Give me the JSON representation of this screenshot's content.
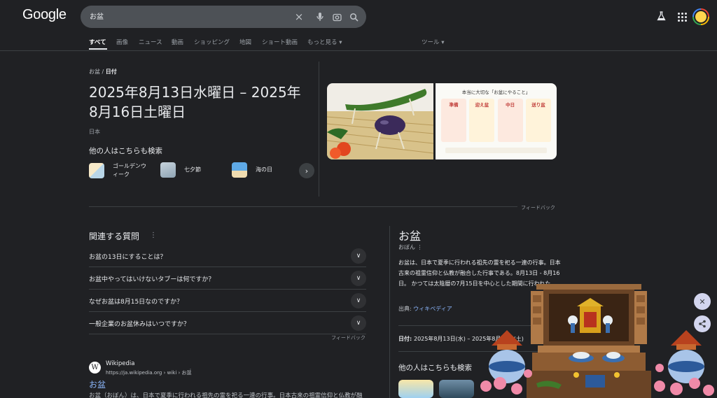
{
  "header": {
    "logo": "Google",
    "search_value": "お盆"
  },
  "tabs": [
    "すべて",
    "画像",
    "ニュース",
    "動画",
    "ショッピング",
    "地図",
    "ショート動画",
    "もっと見る ▾",
    "ツール ▾"
  ],
  "top_panel": {
    "crumb_parent": "お盆",
    "crumb_sep": " / ",
    "crumb_current": "日付",
    "date_line1": "2025年8月13日水曜日 – 2025年",
    "date_line2": "8月16日土曜日",
    "country": "日本",
    "others_heading": "他の人はこちらも検索",
    "others": [
      {
        "line1": "ゴールデンウ",
        "line2": "ィーク"
      },
      {
        "line1": "七夕節",
        "line2": ""
      },
      {
        "line1": "海の日",
        "line2": ""
      }
    ],
    "image2_title": "本当に大切な「お盆にやること」",
    "image2_cols": [
      "準備",
      "迎え盆",
      "中日",
      "送り盆"
    ],
    "feedback": "フィードバック"
  },
  "paa": {
    "heading": "関連する質問",
    "questions": [
      "お盆の13日にすることは？",
      "お盆中やってはいけないタブーは何ですか？",
      "なぜお盆は8月15日なのですか？",
      "一般企業のお盆休みはいつですか？"
    ],
    "feedback": "フィードバック"
  },
  "result": {
    "site_name": "Wikipedia",
    "url": "https://ja.wikipedia.org › wiki › お盆",
    "title": "お盆",
    "snippet": "お盆（おぼん）は、日本で夏季に行われる祖先の霊を祀る一連の行事。日本古来の祖霊信仰と仏教が融"
  },
  "knowledge_panel": {
    "title": "お盆",
    "reading": "おぼん ⋮",
    "description": "お盆は、日本で夏季に行われる祖先の霊を祀る一連の行事。日本古来の祖霊信仰と仏教が融合した行事である。8月13日 - 8月16日。 かつては太陰暦の7月15日を中心とした期間に行われた。",
    "source_label": "出典: ",
    "source_link": "ウィキペディア",
    "date_label": "日付: ",
    "date_value": "2025年8月13日(水) – 2025年8月16日(土)",
    "others_heading": "他の人はこちらも検索"
  },
  "colors": {
    "background": "#202124",
    "link": "#8ab4f8",
    "divider": "#3c4043"
  }
}
